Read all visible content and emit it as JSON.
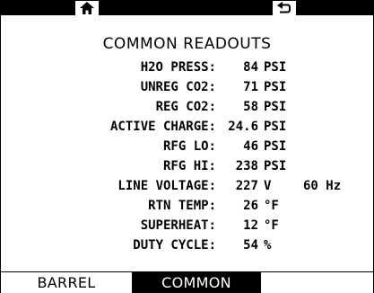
{
  "topbar": {
    "home_icon": "home-icon",
    "back_icon": "back-arrow-icon"
  },
  "title": "COMMON READOUTS",
  "readouts": [
    {
      "label": "H2O PRESS:",
      "value": "84",
      "unit": "PSI",
      "extra": ""
    },
    {
      "label": "UNREG CO2:",
      "value": "71",
      "unit": "PSI",
      "extra": ""
    },
    {
      "label": "REG CO2:",
      "value": "58",
      "unit": "PSI",
      "extra": ""
    },
    {
      "label": "ACTIVE CHARGE:",
      "value": "24.6",
      "unit": "PSI",
      "extra": ""
    },
    {
      "label": "RFG LO:",
      "value": "46",
      "unit": "PSI",
      "extra": ""
    },
    {
      "label": "RFG HI:",
      "value": "238",
      "unit": "PSI",
      "extra": ""
    },
    {
      "label": "LINE VOLTAGE:",
      "value": "227",
      "unit": "V",
      "extra": "60 Hz"
    },
    {
      "label": "RTN TEMP:",
      "value": "26",
      "unit": "°F",
      "extra": ""
    },
    {
      "label": "SUPERHEAT:",
      "value": "12",
      "unit": "°F",
      "extra": ""
    },
    {
      "label": "DUTY CYCLE:",
      "value": "54",
      "unit": "%",
      "extra": ""
    }
  ],
  "tabs": {
    "barrel": "BARREL",
    "common": "COMMON",
    "active": "common"
  }
}
